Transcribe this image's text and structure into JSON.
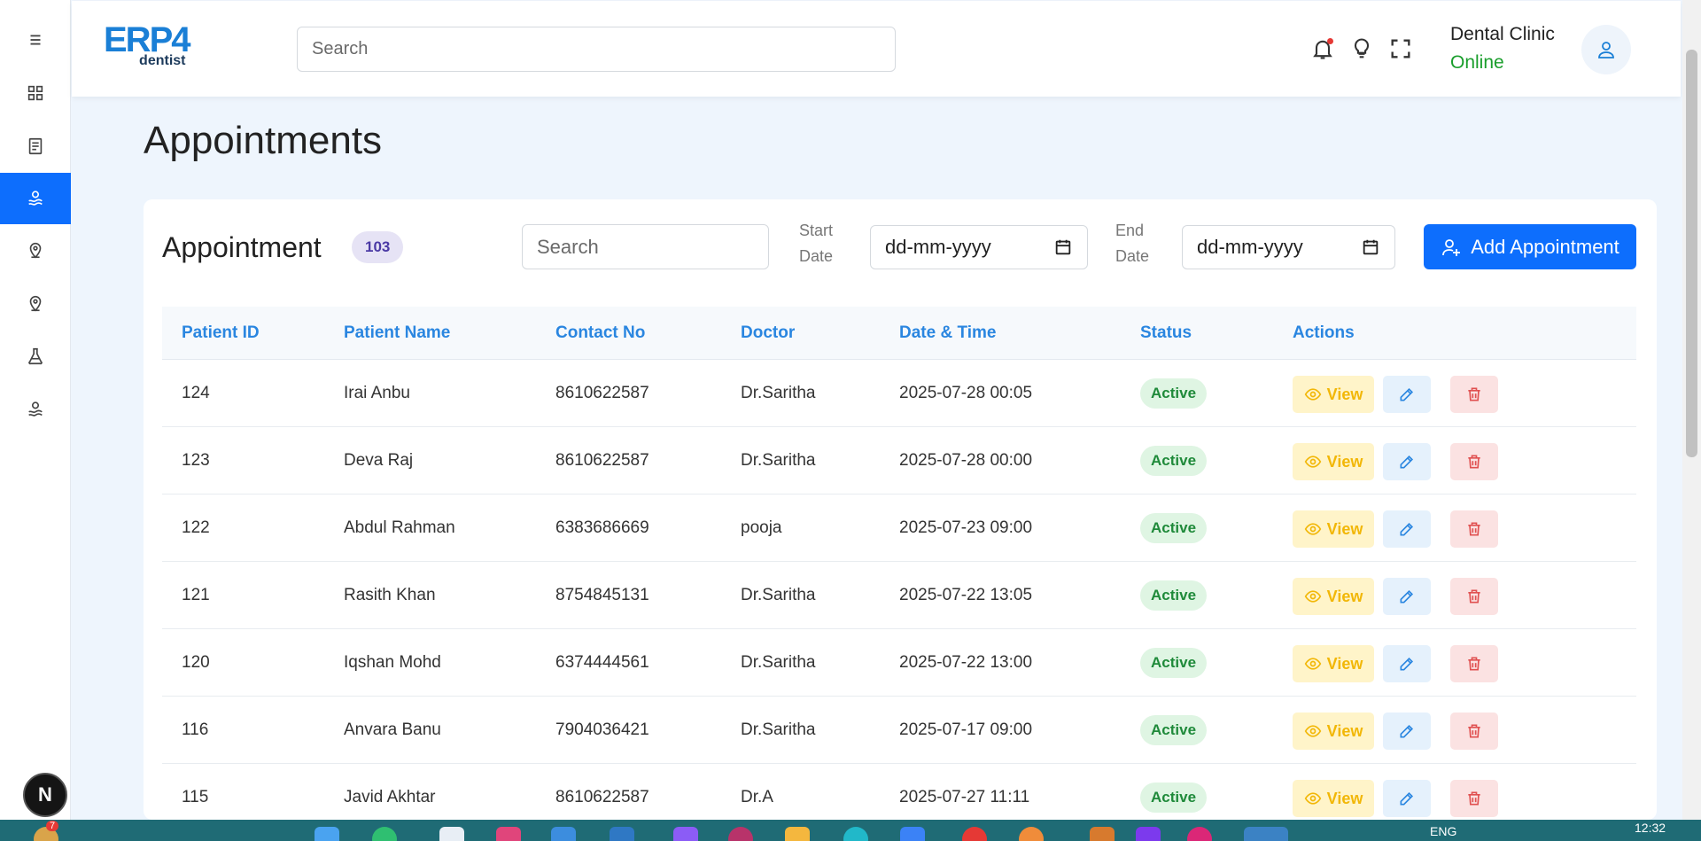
{
  "header": {
    "logo_main": "ERP4",
    "logo_sub": "dentist",
    "search_placeholder": "Search",
    "clinic_name": "Dental Clinic",
    "status": "Online"
  },
  "page": {
    "title": "Appointments"
  },
  "card": {
    "title": "Appointment",
    "count": "103",
    "search_placeholder": "Search",
    "start_label_1": "Start",
    "start_label_2": "Date",
    "start_value": "dd-mm-yyyy",
    "end_label_1": "End",
    "end_label_2": "Date",
    "end_value": "dd-mm-yyyy",
    "add_button": "Add Appointment"
  },
  "table": {
    "columns": [
      "Patient ID",
      "Patient Name",
      "Contact No",
      "Doctor",
      "Date & Time",
      "Status",
      "Actions"
    ],
    "view_label": "View",
    "rows": [
      {
        "id": "124",
        "name": "Irai Anbu",
        "contact": "8610622587",
        "doctor": "Dr.Saritha",
        "datetime": "2025-07-28 00:05",
        "status": "Active"
      },
      {
        "id": "123",
        "name": "Deva Raj",
        "contact": "8610622587",
        "doctor": "Dr.Saritha",
        "datetime": "2025-07-28 00:00",
        "status": "Active"
      },
      {
        "id": "122",
        "name": "Abdul Rahman",
        "contact": "6383686669",
        "doctor": "pooja",
        "datetime": "2025-07-23 09:00",
        "status": "Active"
      },
      {
        "id": "121",
        "name": "Rasith Khan",
        "contact": "8754845131",
        "doctor": "Dr.Saritha",
        "datetime": "2025-07-22 13:05",
        "status": "Active"
      },
      {
        "id": "120",
        "name": "Iqshan Mohd",
        "contact": "6374444561",
        "doctor": "Dr.Saritha",
        "datetime": "2025-07-22 13:00",
        "status": "Active"
      },
      {
        "id": "116",
        "name": "Anvara Banu",
        "contact": "7904036421",
        "doctor": "Dr.Saritha",
        "datetime": "2025-07-17 09:00",
        "status": "Active"
      },
      {
        "id": "115",
        "name": "Javid Akhtar",
        "contact": "8610622587",
        "doctor": "Dr.A",
        "datetime": "2025-07-27 11:11",
        "status": "Active"
      }
    ]
  },
  "sidebar": {
    "items": [
      "menu-icon",
      "dashboard-icon",
      "document-icon",
      "dental-icon",
      "location-icon",
      "location-icon",
      "flask-icon",
      "dental-icon"
    ],
    "active_index": 3,
    "badge": "N"
  },
  "taskbar": {
    "badge": "7",
    "lang": "ENG",
    "time": "12:32"
  },
  "colors": {
    "primary": "#0d6efd",
    "online": "#1a9e2c",
    "status_bg": "#dff5e3",
    "view_bg": "#fff4c9",
    "edit_bg": "#e5f1fc",
    "delete_bg": "#fbe2e2"
  }
}
